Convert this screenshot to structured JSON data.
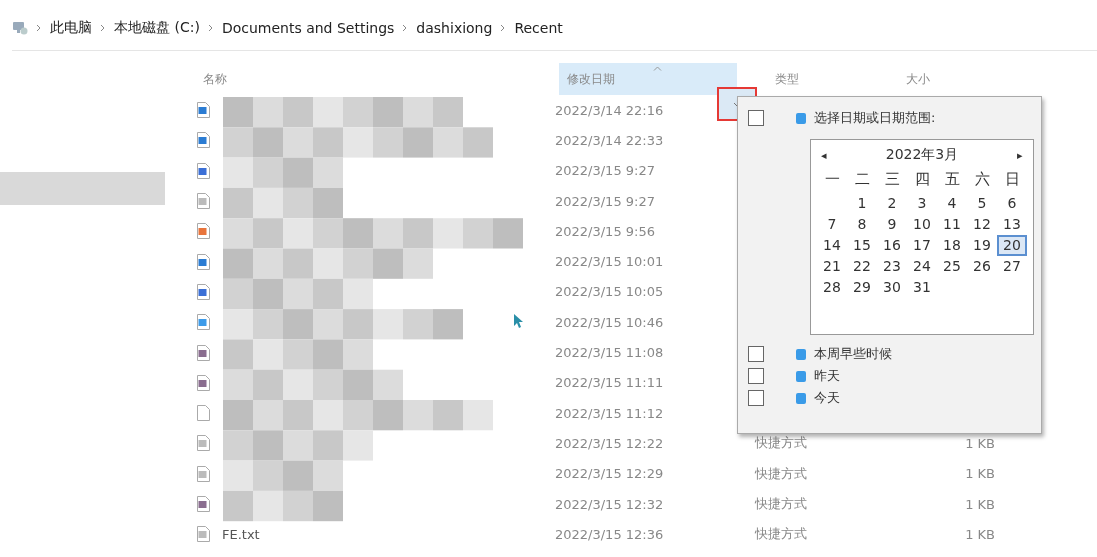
{
  "breadcrumb": [
    "此电脑",
    "本地磁盘 (C:)",
    "Documents and Settings",
    "dashixiong",
    "Recent"
  ],
  "columns": [
    {
      "label": "名称",
      "sorted": false
    },
    {
      "label": "修改日期",
      "sorted": true
    },
    {
      "label": "类型",
      "sorted": false
    },
    {
      "label": "大小",
      "sorted": false
    }
  ],
  "rows": [
    {
      "kind": "document",
      "date": "2022/3/14 22:16"
    },
    {
      "kind": "document",
      "date": "2022/3/14 22:33"
    },
    {
      "kind": "link",
      "date": "2022/3/15 9:27"
    },
    {
      "kind": "text",
      "date": "2022/3/15 9:27"
    },
    {
      "kind": "slides",
      "date": "2022/3/15 9:56"
    },
    {
      "kind": "document",
      "date": "2022/3/15 10:01"
    },
    {
      "kind": "link",
      "date": "2022/3/15 10:05"
    },
    {
      "kind": "folder",
      "date": "2022/3/15 10:46"
    },
    {
      "kind": "image",
      "date": "2022/3/15 11:08"
    },
    {
      "kind": "image",
      "date": "2022/3/15 11:11"
    },
    {
      "kind": "blank",
      "date": "2022/3/15 11:12"
    },
    {
      "kind": "text",
      "date": "2022/3/15 12:22",
      "type": "快捷方式",
      "size": "1 KB"
    },
    {
      "kind": "text",
      "date": "2022/3/15 12:29",
      "type": "快捷方式",
      "size": "1 KB"
    },
    {
      "kind": "image",
      "date": "2022/3/15 12:32",
      "type": "快捷方式",
      "size": "1 KB"
    },
    {
      "kind": "text",
      "name": "FE.txt",
      "date": "2022/3/15 12:36",
      "type": "快捷方式",
      "size": "1 KB"
    }
  ],
  "filter_menu": {
    "open": true,
    "options": [
      {
        "label": "选择日期或日期范围:",
        "checked": false
      },
      {
        "label": "本周早些时候",
        "checked": false
      },
      {
        "label": "昨天",
        "checked": false
      },
      {
        "label": "今天",
        "checked": false
      }
    ],
    "calendar": {
      "month": "2022年3月",
      "prev": "◂",
      "next": "▸",
      "weekdays": [
        "一",
        "二",
        "三",
        "四",
        "五",
        "六",
        "日"
      ],
      "weeks": [
        [
          {
            "day": "1",
            "selected": false
          },
          {
            "day": "2",
            "selected": false
          },
          {
            "day": "3",
            "selected": false
          },
          {
            "day": "4",
            "selected": false
          },
          {
            "day": "5",
            "selected": false
          },
          {
            "day": "6",
            "selected": false
          }
        ],
        [
          {
            "day": "7",
            "selected": false
          },
          {
            "day": "8",
            "selected": false
          },
          {
            "day": "9",
            "selected": false
          },
          {
            "day": "10",
            "selected": false
          },
          {
            "day": "11",
            "selected": false
          },
          {
            "day": "12",
            "selected": false
          },
          {
            "day": "13",
            "selected": false
          }
        ],
        [
          {
            "day": "14",
            "selected": false
          },
          {
            "day": "15",
            "selected": false
          },
          {
            "day": "16",
            "selected": false
          },
          {
            "day": "17",
            "selected": false
          },
          {
            "day": "18",
            "selected": false
          },
          {
            "day": "19",
            "selected": false
          },
          {
            "day": "20",
            "selected": true
          }
        ],
        [
          {
            "day": "21",
            "selected": false
          },
          {
            "day": "22",
            "selected": false
          },
          {
            "day": "23",
            "selected": false
          },
          {
            "day": "24",
            "selected": false
          },
          {
            "day": "25",
            "selected": false
          },
          {
            "day": "26",
            "selected": false
          },
          {
            "day": "27",
            "selected": false
          }
        ],
        [
          {
            "day": "28",
            "selected": false
          },
          {
            "day": "29",
            "selected": false
          },
          {
            "day": "30",
            "selected": false
          },
          {
            "day": "31",
            "selected": false
          }
        ]
      ]
    }
  }
}
